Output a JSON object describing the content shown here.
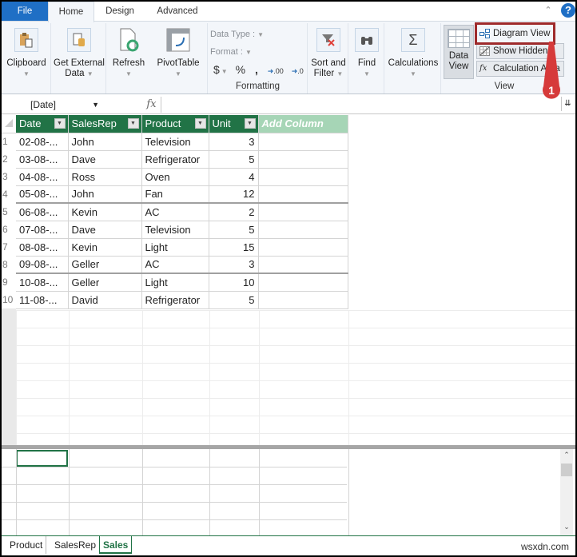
{
  "tabs": [
    {
      "label": "File",
      "active": false
    },
    {
      "label": "Home",
      "active": true
    },
    {
      "label": "Design",
      "active": false
    },
    {
      "label": "Advanced",
      "active": false
    }
  ],
  "help_label": "?",
  "ribbon": {
    "clipboard": "Clipboard",
    "get_external_data": [
      "Get External",
      "Data"
    ],
    "refresh": "Refresh",
    "pivot_table": "PivotTable",
    "formatting": {
      "data_type_label": "Data Type :",
      "format_label": "Format :",
      "currency": "$",
      "percent": "%",
      "comma": "͵",
      "inc_decimal": ".00",
      "dec_decimal": ".0",
      "group_label": "Formatting"
    },
    "sort_filter": [
      "Sort and",
      "Filter"
    ],
    "find": "Find",
    "calculations": "Calculations",
    "view": {
      "data_view": [
        "Data",
        "View"
      ],
      "diagram_view": "Diagram View",
      "show_hidden": "Show Hidden",
      "calculation_area": "Calculation Area",
      "group_label": "View"
    },
    "annotation_number": "1",
    "highlight_color": "#9e2a2b"
  },
  "formula_bar": {
    "name_box": "[Date]",
    "fx": "fx",
    "formula": ""
  },
  "table": {
    "columns": [
      "Date",
      "SalesRep",
      "Product",
      "Unit"
    ],
    "add_column": "Add Column",
    "rows": [
      {
        "n": "1",
        "date": "02-08-...",
        "rep": "John",
        "product": "Television",
        "unit": "3"
      },
      {
        "n": "2",
        "date": "03-08-...",
        "rep": "Dave",
        "product": "Refrigerator",
        "unit": "5"
      },
      {
        "n": "3",
        "date": "04-08-...",
        "rep": "Ross",
        "product": "Oven",
        "unit": "4"
      },
      {
        "n": "4",
        "date": "05-08-...",
        "rep": "John",
        "product": "Fan",
        "unit": "12"
      },
      {
        "n": "5",
        "date": "06-08-...",
        "rep": "Kevin",
        "product": "AC",
        "unit": "2"
      },
      {
        "n": "6",
        "date": "07-08-...",
        "rep": "Dave",
        "product": "Television",
        "unit": "5"
      },
      {
        "n": "7",
        "date": "08-08-...",
        "rep": "Kevin",
        "product": "Light",
        "unit": "15"
      },
      {
        "n": "8",
        "date": "09-08-...",
        "rep": "Geller",
        "product": "AC",
        "unit": "3"
      },
      {
        "n": "9",
        "date": "10-08-...",
        "rep": "Geller",
        "product": "Light",
        "unit": "10"
      },
      {
        "n": "10",
        "date": "11-08-...",
        "rep": "David",
        "product": "Refrigerator",
        "unit": "5"
      }
    ]
  },
  "sheets": [
    {
      "label": "Product",
      "active": false
    },
    {
      "label": "SalesRep",
      "active": false
    },
    {
      "label": "Sales",
      "active": true
    }
  ],
  "watermark": "wsxdn.com",
  "colors": {
    "accent_green": "#217346",
    "file_blue": "#1f6fc5",
    "add_column_bg": "#a6d5b6"
  }
}
